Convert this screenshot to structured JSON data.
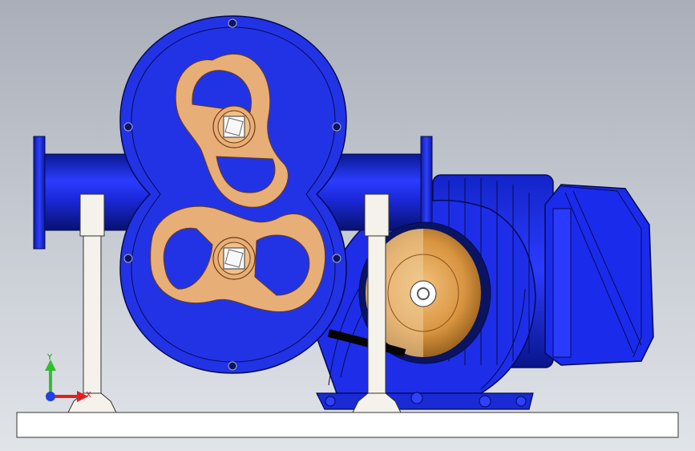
{
  "viewport": {
    "background_top": "#a9aeb8",
    "background_bottom": "#e1e4e9"
  },
  "model": {
    "pump_casing_color": "#2233e6",
    "rotor_color": "#e8ae78",
    "support_color": "#f4f2ea",
    "base_color": "#ffffff",
    "coupling_color": "#c8862e",
    "components": [
      "pump-casing",
      "upper-rotor",
      "lower-rotor",
      "suction-pipe",
      "left-support",
      "right-support",
      "motor",
      "motor-junction-box",
      "coupling",
      "base-plate"
    ]
  },
  "triad": {
    "y_label": "Y",
    "x_label": "X",
    "y_color": "#2fbf2f",
    "x_color": "#e02020",
    "z_color": "#2040e0"
  }
}
